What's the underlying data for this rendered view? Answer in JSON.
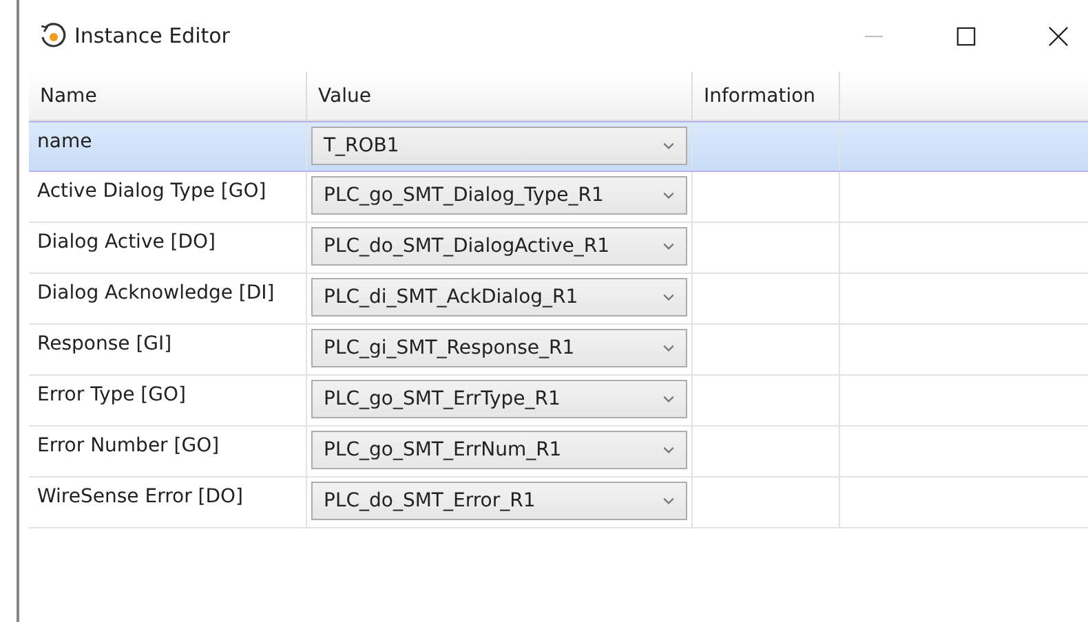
{
  "window": {
    "title": "Instance Editor"
  },
  "table": {
    "columns": [
      "Name",
      "Value",
      "Information"
    ],
    "rows": [
      {
        "name": "name",
        "value": "T_ROB1",
        "selected": true
      },
      {
        "name": "Active Dialog Type [GO]",
        "value": "PLC_go_SMT_Dialog_Type_R1",
        "selected": false
      },
      {
        "name": "Dialog Active [DO]",
        "value": "PLC_do_SMT_DialogActive_R1",
        "selected": false
      },
      {
        "name": "Dialog Acknowledge [DI]",
        "value": "PLC_di_SMT_AckDialog_R1",
        "selected": false
      },
      {
        "name": "Response [GI]",
        "value": "PLC_gi_SMT_Response_R1",
        "selected": false
      },
      {
        "name": "Error Type [GO]",
        "value": "PLC_go_SMT_ErrType_R1",
        "selected": false
      },
      {
        "name": "Error Number [GO]",
        "value": "PLC_go_SMT_ErrNum_R1",
        "selected": false
      },
      {
        "name": "WireSense Error [DO]",
        "value": "PLC_do_SMT_Error_R1",
        "selected": false
      }
    ]
  }
}
